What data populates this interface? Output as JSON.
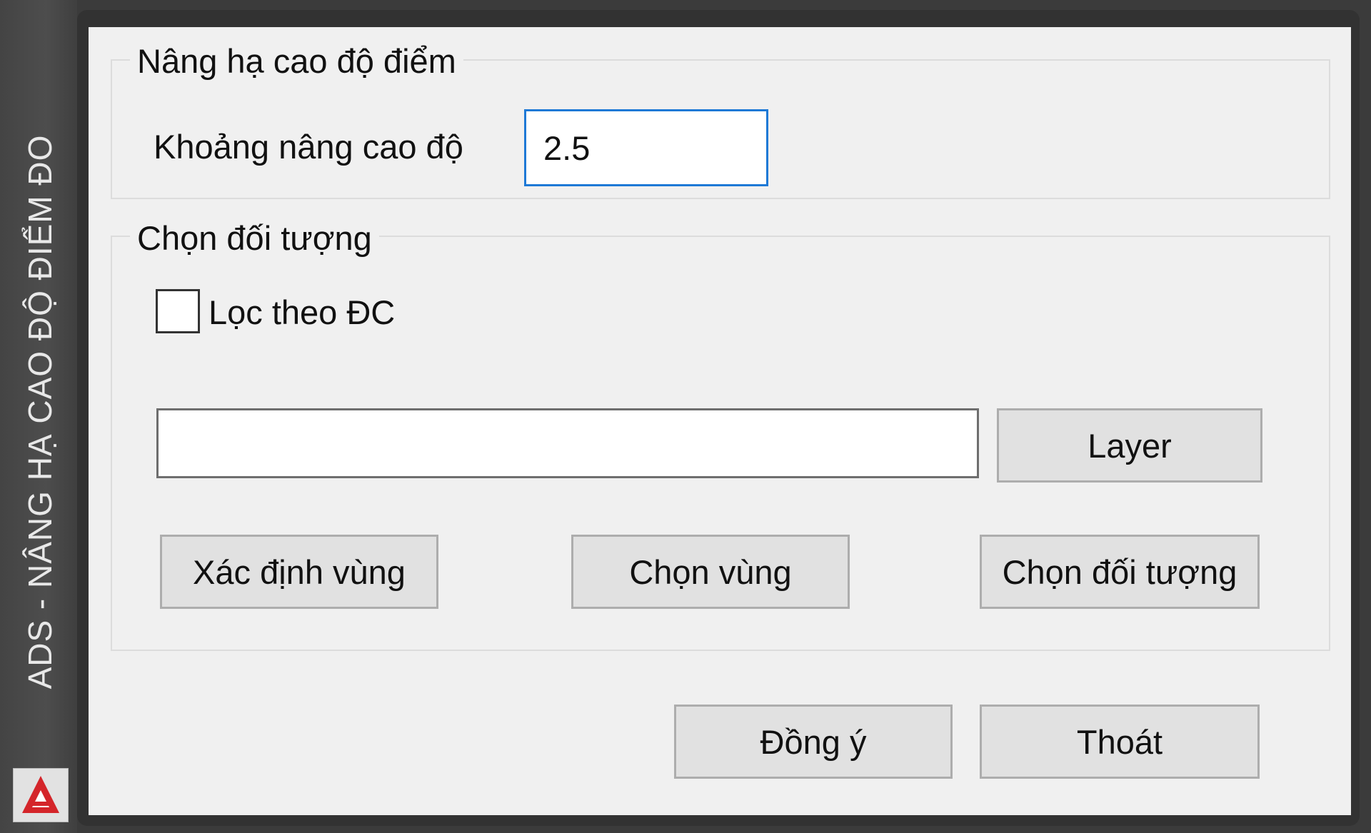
{
  "window": {
    "title": "ADS - NÂNG HẠ CAO ĐỘ ĐIỂM ĐO",
    "icon": "autocad-icon",
    "icon_color": "#d4252a",
    "accent": "#1e79d6"
  },
  "group_elevation": {
    "legend": "Nâng hạ cao độ điểm",
    "field_label": "Khoảng nâng cao độ",
    "field_value": "2.5"
  },
  "group_select": {
    "legend": "Chọn đối tượng",
    "filter_checkbox_label": "Lọc theo ĐC",
    "filter_checked": false,
    "layer_value": "",
    "layer_button": "Layer",
    "define_region_button": "Xác định vùng",
    "select_region_button": "Chọn vùng",
    "select_object_button": "Chọn đối tượng"
  },
  "footer": {
    "ok_button": "Đồng ý",
    "exit_button": "Thoát"
  }
}
